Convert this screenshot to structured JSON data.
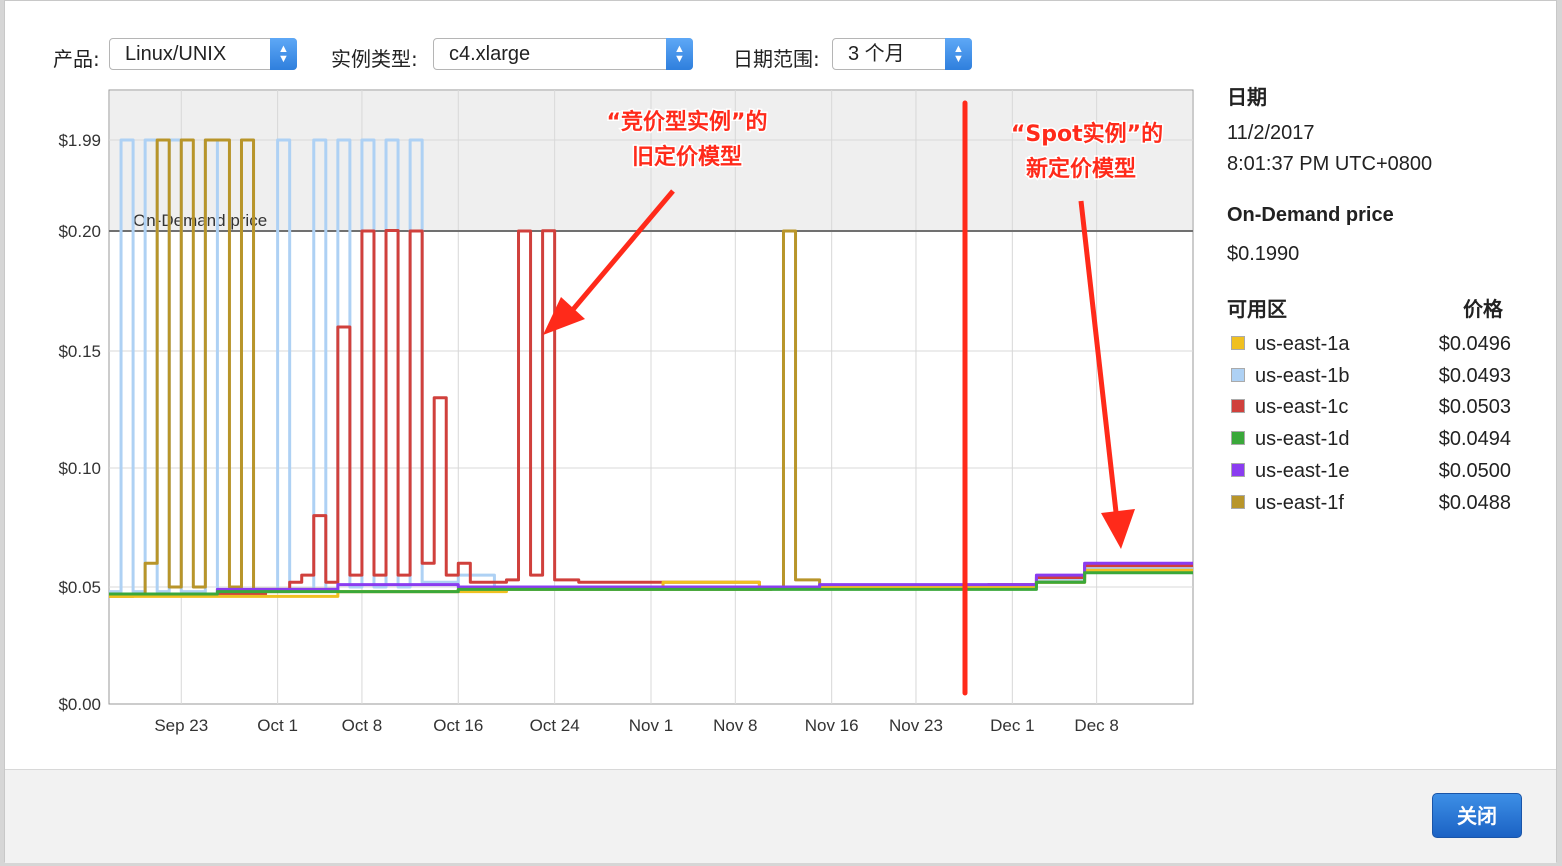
{
  "toolbar": {
    "product_label": "产品:",
    "product_value": "Linux/UNIX",
    "instance_type_label": "实例类型:",
    "instance_type_value": "c4.xlarge",
    "date_range_label": "日期范围:",
    "date_range_value": "3 个月"
  },
  "side": {
    "date_title": "日期",
    "date_value": "11/2/2017",
    "time_value": "8:01:37 PM UTC+0800",
    "ondemand_title": "On-Demand price",
    "ondemand_value": "$0.1990",
    "zone_header": "可用区",
    "price_header": "价格"
  },
  "legend": [
    {
      "name": "us-east-1a",
      "price": "$0.0496",
      "color": "#f0c020"
    },
    {
      "name": "us-east-1b",
      "price": "$0.0493",
      "color": "#aed1f4"
    },
    {
      "name": "us-east-1c",
      "price": "$0.0503",
      "color": "#d0403c"
    },
    {
      "name": "us-east-1d",
      "price": "$0.0494",
      "color": "#3aa83a"
    },
    {
      "name": "us-east-1e",
      "price": "$0.0500",
      "color": "#8a3cf0"
    },
    {
      "name": "us-east-1f",
      "price": "$0.0488",
      "color": "#b8952a"
    }
  ],
  "annotations": {
    "old_model_line1": "“竞价型实例”的",
    "old_model_line2": "旧定价模型",
    "new_model_line1": "“Spot实例”的",
    "new_model_line2": "新定价模型",
    "color": "#ff2a1a"
  },
  "chart_data": {
    "type": "line",
    "title": "",
    "xlabel": "",
    "ylabel": "",
    "ondemand_label": "On-Demand price",
    "ondemand_price": 0.199,
    "y_ticks": [
      "$1.99",
      "$0.20",
      "$0.15",
      "$0.10",
      "$0.05",
      "$0.00"
    ],
    "x_ticks": [
      "Sep 23",
      "Oct 1",
      "Oct 8",
      "Oct 16",
      "Oct 24",
      "Nov 1",
      "Nov 8",
      "Nov 16",
      "Nov 23",
      "Dec 1",
      "Dec 8"
    ],
    "x_tick_days": [
      7,
      15,
      22,
      30,
      38,
      46,
      53,
      61,
      68,
      76,
      83
    ],
    "x_range_days": [
      1,
      91
    ],
    "x_day_zero": "Sep 15",
    "grid": true,
    "series": [
      {
        "name": "us-east-1b",
        "color": "#aed1f4",
        "points": [
          [
            1,
            0.048
          ],
          [
            2,
            1.99
          ],
          [
            3,
            0.048
          ],
          [
            4,
            1.99
          ],
          [
            5,
            0.048
          ],
          [
            6,
            1.99
          ],
          [
            7,
            0.048
          ],
          [
            9,
            1.99
          ],
          [
            10,
            0.048
          ],
          [
            12,
            1.99
          ],
          [
            13,
            0.049
          ],
          [
            15,
            1.99
          ],
          [
            16,
            0.049
          ],
          [
            18,
            1.99
          ],
          [
            19,
            0.049
          ],
          [
            20,
            1.99
          ],
          [
            21,
            0.05
          ],
          [
            22,
            1.99
          ],
          [
            23,
            0.05
          ],
          [
            24,
            1.99
          ],
          [
            25,
            0.05
          ],
          [
            26,
            1.99
          ],
          [
            27,
            0.052
          ],
          [
            30,
            0.055
          ],
          [
            33,
            0.05
          ],
          [
            40,
            0.05
          ],
          [
            60,
            0.05
          ],
          [
            74,
            0.05
          ],
          [
            78,
            0.053
          ],
          [
            82,
            0.058
          ],
          [
            91,
            0.058
          ]
        ]
      },
      {
        "name": "us-east-1c",
        "color": "#d0403c",
        "points": [
          [
            1,
            0.047
          ],
          [
            14,
            0.048
          ],
          [
            16,
            0.052
          ],
          [
            17,
            0.055
          ],
          [
            18,
            0.08
          ],
          [
            19,
            0.052
          ],
          [
            20,
            0.16
          ],
          [
            21,
            0.055
          ],
          [
            22,
            0.2
          ],
          [
            23,
            0.055
          ],
          [
            24,
            0.21
          ],
          [
            25,
            0.055
          ],
          [
            26,
            0.2
          ],
          [
            27,
            0.06
          ],
          [
            28,
            0.13
          ],
          [
            29,
            0.055
          ],
          [
            30,
            0.06
          ],
          [
            31,
            0.052
          ],
          [
            33,
            0.052
          ],
          [
            34,
            0.053
          ],
          [
            35,
            0.2
          ],
          [
            36,
            0.055
          ],
          [
            37,
            0.205
          ],
          [
            38,
            0.053
          ],
          [
            40,
            0.052
          ],
          [
            48,
            0.052
          ],
          [
            55,
            0.05
          ],
          [
            74,
            0.051
          ],
          [
            78,
            0.054
          ],
          [
            82,
            0.059
          ],
          [
            91,
            0.059
          ]
        ]
      },
      {
        "name": "us-east-1f",
        "color": "#b8952a",
        "points": [
          [
            1,
            0.046
          ],
          [
            3,
            0.047
          ],
          [
            4,
            0.06
          ],
          [
            5,
            1.99
          ],
          [
            6,
            0.05
          ],
          [
            7,
            1.99
          ],
          [
            8,
            0.05
          ],
          [
            9,
            1.99
          ],
          [
            10,
            1.99
          ],
          [
            11,
            0.05
          ],
          [
            12,
            1.99
          ],
          [
            13,
            0.049
          ],
          [
            15,
            0.049
          ],
          [
            20,
            0.048
          ],
          [
            30,
            0.049
          ],
          [
            40,
            0.049
          ],
          [
            56,
            0.05
          ],
          [
            57,
            0.2
          ],
          [
            58,
            0.053
          ],
          [
            60,
            0.05
          ],
          [
            74,
            0.05
          ],
          [
            78,
            0.052
          ],
          [
            82,
            0.057
          ],
          [
            91,
            0.057
          ]
        ]
      },
      {
        "name": "us-east-1a",
        "color": "#f0c020",
        "points": [
          [
            1,
            0.046
          ],
          [
            20,
            0.048
          ],
          [
            34,
            0.05
          ],
          [
            46,
            0.05
          ],
          [
            47,
            0.052
          ],
          [
            55,
            0.05
          ],
          [
            74,
            0.05
          ],
          [
            78,
            0.052
          ],
          [
            82,
            0.057
          ],
          [
            91,
            0.057
          ]
        ]
      },
      {
        "name": "us-east-1e",
        "color": "#8a3cf0",
        "points": [
          [
            1,
            0.047
          ],
          [
            10,
            0.049
          ],
          [
            20,
            0.051
          ],
          [
            30,
            0.05
          ],
          [
            40,
            0.05
          ],
          [
            55,
            0.05
          ],
          [
            60,
            0.051
          ],
          [
            74,
            0.051
          ],
          [
            78,
            0.055
          ],
          [
            82,
            0.06
          ],
          [
            91,
            0.06
          ]
        ]
      },
      {
        "name": "us-east-1d",
        "color": "#3aa83a",
        "points": [
          [
            1,
            0.047
          ],
          [
            10,
            0.048
          ],
          [
            30,
            0.049
          ],
          [
            60,
            0.049
          ],
          [
            74,
            0.049
          ],
          [
            78,
            0.052
          ],
          [
            82,
            0.056
          ],
          [
            91,
            0.056
          ]
        ]
      }
    ]
  },
  "footer": {
    "close_label": "关闭"
  }
}
